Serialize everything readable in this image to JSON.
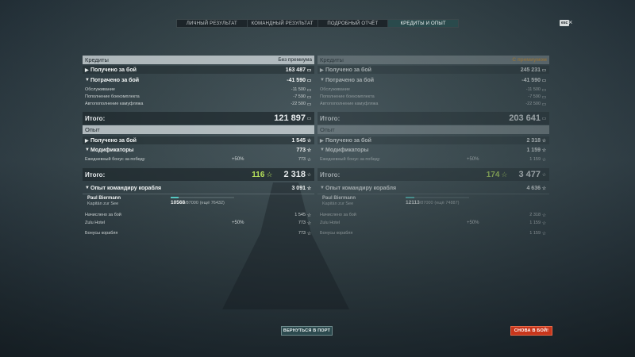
{
  "tabs": [
    {
      "label": "ЛИЧНЫЙ РЕЗУЛЬТАТ"
    },
    {
      "label": "КОМАНДНЫЙ РЕЗУЛЬТАТ"
    },
    {
      "label": "ПОДРОБНЫЙ ОТЧЁТ"
    },
    {
      "label": "КРЕДИТЫ И ОПЫТ"
    }
  ],
  "active_tab": "КРЕДИТЫ И ОПЫТ",
  "close": {
    "esc": "esc",
    "x": "×"
  },
  "left": {
    "credits": {
      "title": "Кредиты",
      "mode": "Без премиума",
      "earned_label": "Получено за бой",
      "earned": "163 487",
      "spent_label": "Потрачено за бой",
      "spent": "-41 590",
      "items": [
        {
          "label": "Обслуживание",
          "value": "-11 500"
        },
        {
          "label": "Пополнение боекомплекта",
          "value": "-7 590"
        },
        {
          "label": "Автопополнение камуфляжа",
          "value": "-22 500"
        }
      ],
      "total_label": "Итого:",
      "total": "121 897"
    },
    "xp": {
      "title": "Опыт",
      "earned_label": "Получено за бой",
      "earned": "1 545",
      "mods_label": "Модификаторы",
      "mods": "773",
      "daily_label": "Ежедневный бонус за победу",
      "daily_pct": "+50%",
      "daily": "773",
      "total_label": "Итого:",
      "total_free": "116",
      "total": "2 318",
      "captain_label": "Опыт командиру корабля",
      "captain_xp": "3 091"
    },
    "captain": {
      "name": "Paul Biermann",
      "ship": "Kapitän zur See",
      "current": "10568",
      "max": "/87000",
      "remaining": "(ещё 76432)",
      "progress": 0.121
    },
    "captain_rows": [
      {
        "label": "Начислено за бой",
        "pct": "",
        "value": "1 545"
      },
      {
        "label": "Zulu Hotel",
        "pct": "+50%",
        "value": "773"
      },
      {
        "label": "Бонусы корабля",
        "pct": "",
        "value": "773"
      }
    ]
  },
  "right": {
    "credits": {
      "title": "Кредиты",
      "mode": "С премиумом",
      "earned_label": "Получено за бой",
      "earned": "245 231",
      "spent_label": "Потрачено за бой",
      "spent": "-41 590",
      "items": [
        {
          "label": "Обслуживание",
          "value": "-11 500"
        },
        {
          "label": "Пополнение боекомплекта",
          "value": "-7 590"
        },
        {
          "label": "Автопополнение камуфляжа",
          "value": "-22 500"
        }
      ],
      "total_label": "Итого:",
      "total": "203 641"
    },
    "xp": {
      "title": "Опыт",
      "earned_label": "Получено за бой",
      "earned": "2 318",
      "mods_label": "Модификаторы",
      "mods": "1 159",
      "daily_label": "Ежедневный бонус за победу",
      "daily_pct": "+50%",
      "daily": "1 159",
      "total_label": "Итого:",
      "total_free": "174",
      "total": "3 477",
      "captain_label": "Опыт командиру корабля",
      "captain_xp": "4 636"
    },
    "captain": {
      "name": "Paul Biermann",
      "ship": "Kapitän zur See",
      "current": "12113",
      "max": "/87000",
      "remaining": "(ещё 74887)",
      "progress": 0.139
    },
    "captain_rows": [
      {
        "label": "Начислено за бой",
        "pct": "",
        "value": "2 318"
      },
      {
        "label": "Zulu Hotel",
        "pct": "+50%",
        "value": "1 159"
      },
      {
        "label": "Бонусы корабля",
        "pct": "",
        "value": "1 159"
      }
    ]
  },
  "buttons": {
    "port": "ВЕРНУТЬСЯ В ПОРТ",
    "battle": "СНОВА В БОЙ!"
  },
  "colors": {
    "accent": "#56c6c0",
    "free_xp": "#b5e05a",
    "battle_button": "#c8361c",
    "premium": "#d89a3c"
  }
}
